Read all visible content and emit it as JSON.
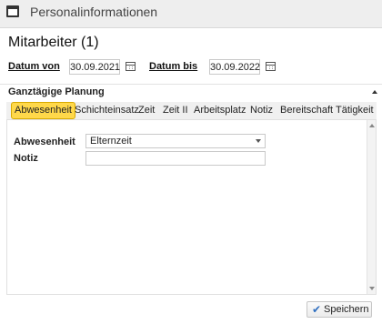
{
  "window": {
    "title": "Personalinformationen",
    "icon": "window-icon"
  },
  "heading": "Mitarbeiter (1)",
  "date_from": {
    "label": "Datum von",
    "value": "30.09.2021",
    "icon": "calendar-icon"
  },
  "date_to": {
    "label": "Datum bis",
    "value": "30.09.2022",
    "icon": "calendar-icon"
  },
  "section": {
    "title": "Ganztägige Planung",
    "icon": "collapse-up-icon"
  },
  "tabs": [
    {
      "label": "Abwesenheit",
      "active": true
    },
    {
      "label": "Schichteinsatz"
    },
    {
      "label": "Zeit"
    },
    {
      "label": "Zeit II"
    },
    {
      "label": "Arbeitsplatz"
    },
    {
      "label": "Notiz"
    },
    {
      "label": "Bereitschaft"
    },
    {
      "label": "Tätigkeit"
    }
  ],
  "form": {
    "absence_label": "Abwesenheit",
    "absence_value": "Elternzeit",
    "note_label": "Notiz",
    "note_value": ""
  },
  "save": {
    "label": "Speichern",
    "icon": "checkmark-icon"
  },
  "colors": {
    "active_tab": "#ffd84a",
    "check": "#2f6fc0"
  }
}
